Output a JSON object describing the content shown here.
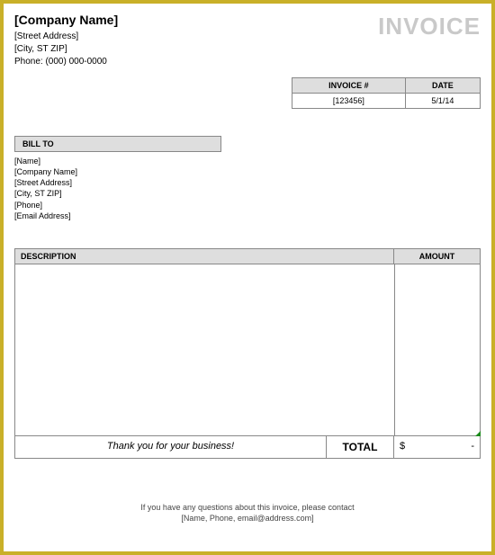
{
  "header": {
    "company_name": "[Company Name]",
    "invoice_title": "INVOICE",
    "street": "[Street Address]",
    "city_st_zip": "[City, ST  ZIP]",
    "phone": "Phone: (000) 000-0000"
  },
  "meta": {
    "invoice_no_label": "INVOICE #",
    "date_label": "DATE",
    "invoice_no": "[123456]",
    "date": "5/1/14"
  },
  "bill_to": {
    "label": "BILL TO",
    "name": "[Name]",
    "company": "[Company Name]",
    "street": "[Street Address]",
    "city_st_zip": "[City, ST  ZIP]",
    "phone": "[Phone]",
    "email": "[Email Address]"
  },
  "items": {
    "desc_header": "DESCRIPTION",
    "amount_header": "AMOUNT"
  },
  "totals": {
    "thank_you": "Thank you for your business!",
    "total_label": "TOTAL",
    "currency": "$",
    "amount": "-"
  },
  "footer": {
    "line1": "If you have any questions about this invoice, please contact",
    "line2": "[Name, Phone, email@address.com]"
  }
}
